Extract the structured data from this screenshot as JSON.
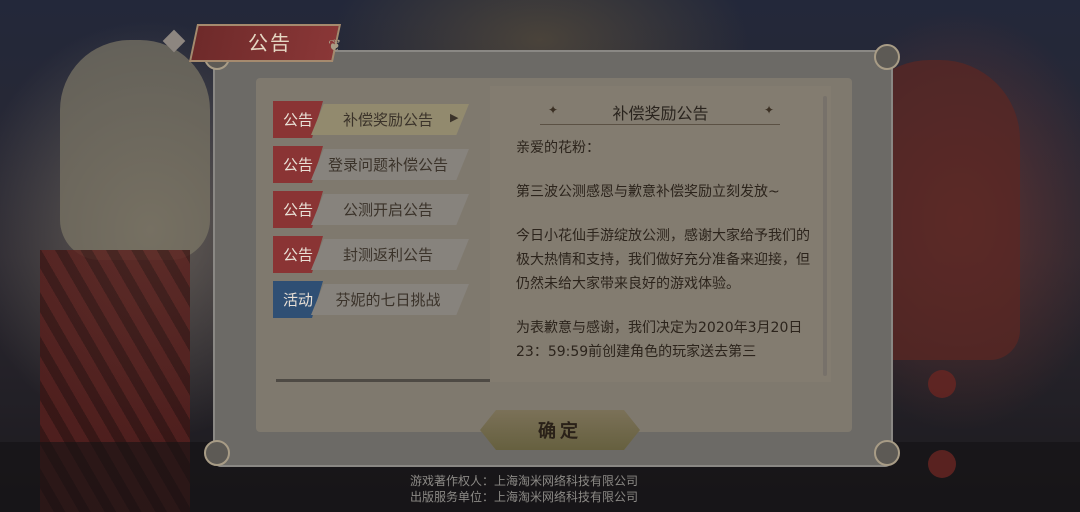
{
  "dialog": {
    "title": "公告",
    "confirm_label": "确定"
  },
  "tabs": [
    {
      "badge": "公告",
      "label": "补偿奖励公告",
      "badge_color": "#8a3434",
      "active": true
    },
    {
      "badge": "公告",
      "label": "登录问题补偿公告",
      "badge_color": "#8a3434",
      "active": false
    },
    {
      "badge": "公告",
      "label": "公测开启公告",
      "badge_color": "#8a3434",
      "active": false
    },
    {
      "badge": "公告",
      "label": "封测返利公告",
      "badge_color": "#8a3434",
      "active": false
    },
    {
      "badge": "活动",
      "label": "芬妮的七日挑战",
      "badge_color": "#2f4f74",
      "active": false
    }
  ],
  "content": {
    "title": "补偿奖励公告",
    "paragraphs": [
      "亲爱的花粉：",
      "第三波公测感恩与歉意补偿奖励立刻发放~",
      "今日小花仙手游绽放公测，感谢大家给予我们的极大热情和支持，我们做好充分准备来迎接，但仍然未给大家带来良好的游戏体验。",
      "为表歉意与感谢，我们决定为2020年3月20日23：59:59前创建角色的玩家送去第三"
    ]
  },
  "footer": {
    "copyright_owner": "游戏著作权人：上海淘米网络科技有限公司",
    "publisher": "出版服务单位：上海淘米网络科技有限公司"
  },
  "colors": {
    "notice_badge": "#8a3434",
    "event_badge": "#2f4f74"
  }
}
